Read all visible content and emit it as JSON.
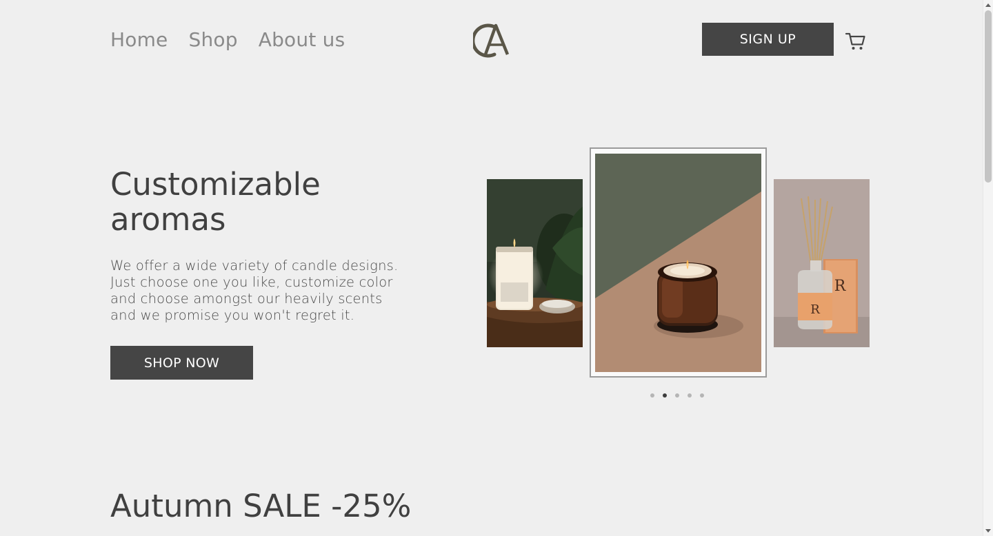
{
  "header": {
    "nav": [
      "Home",
      "Shop",
      "About us"
    ],
    "signup_label": "SIGN UP",
    "logo_icon": "ca-monogram-logo",
    "cart_icon": "shopping-cart-icon",
    "brand_color": "#5a5648"
  },
  "hero": {
    "title": "Customizable aromas",
    "description": "We offer a wide variety of candle designs. Just choose one you like, customize color and choose amongst our heavily scents and we promise you won't regret it.",
    "cta_label": "SHOP NOW"
  },
  "carousel": {
    "slides": [
      "candle-with-plant-image",
      "amber-jar-candle-image",
      "reed-diffuser-image"
    ],
    "dot_count": 5,
    "active_dot": 2
  },
  "sale": {
    "title": "Autumn SALE -25%"
  },
  "colors": {
    "background": "#efefef",
    "button": "#454545",
    "text": "#404040",
    "nav_text": "#8a8a8a"
  }
}
